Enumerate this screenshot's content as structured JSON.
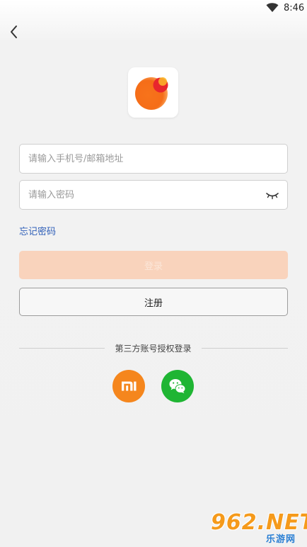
{
  "status_bar": {
    "time": "8:46",
    "wifi_icon": "wifi-icon"
  },
  "header": {
    "back_icon": "back-arrow-icon"
  },
  "logo": {
    "icon": "app-logo-icon",
    "colors": {
      "primary": "#f7731b",
      "accent": "#e8262d",
      "highlight": "#fbb829"
    }
  },
  "form": {
    "phone_placeholder": "请输入手机号/邮箱地址",
    "phone_value": "",
    "password_placeholder": "请输入密码",
    "password_value": "",
    "eye_icon": "eye-closed-icon",
    "forgot_label": "忘记密码"
  },
  "buttons": {
    "login_label": "登录",
    "register_label": "注册"
  },
  "third_party": {
    "divider_label": "第三方账号授权登录",
    "providers": [
      {
        "name": "xiaomi-icon",
        "color": "#f5861d"
      },
      {
        "name": "wechat-icon",
        "color": "#1fb533"
      }
    ]
  },
  "watermark": {
    "main": "962.NET",
    "sub": "乐游网"
  },
  "colors": {
    "link": "#2f5fb8",
    "login_disabled_bg": "#f9d3bc",
    "register_border": "#9c9c9c"
  }
}
